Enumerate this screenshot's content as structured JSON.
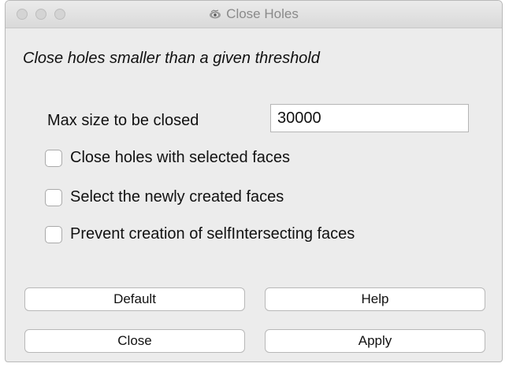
{
  "window": {
    "title": "Close Holes",
    "title_icon": "mesh-eye-icon"
  },
  "description": "Close holes smaller than a given threshold",
  "max_size": {
    "label": "Max size to be closed",
    "value": "30000"
  },
  "options": [
    {
      "label": "Close holes with selected faces",
      "checked": false
    },
    {
      "label": "Select the newly created faces",
      "checked": false
    },
    {
      "label": "Prevent creation of selfIntersecting faces",
      "checked": false
    }
  ],
  "buttons": {
    "default": "Default",
    "help": "Help",
    "close": "Close",
    "apply": "Apply"
  }
}
